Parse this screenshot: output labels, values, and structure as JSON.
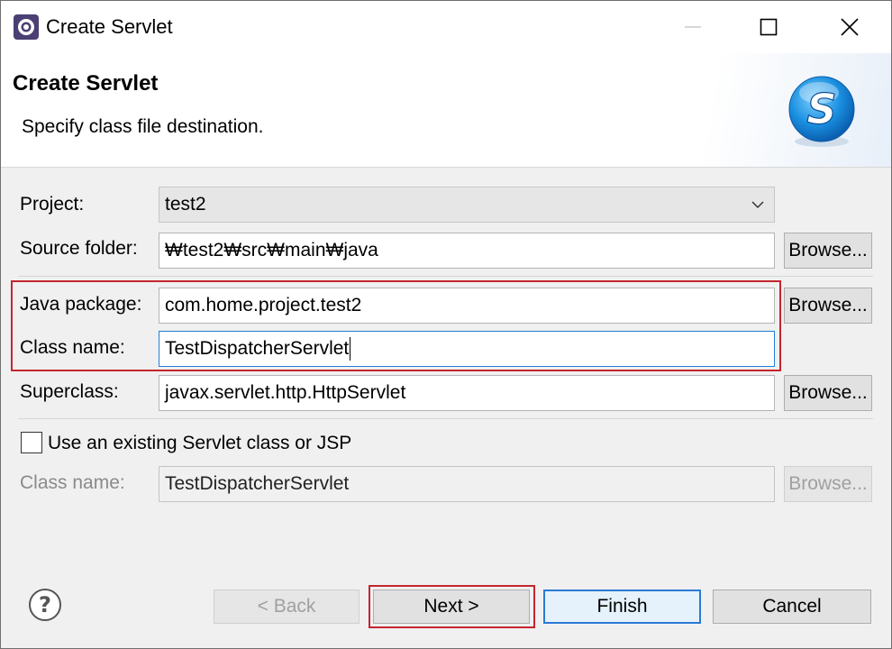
{
  "window": {
    "title": "Create Servlet",
    "controls": {
      "minimize": "minimize",
      "maximize": "maximize",
      "close": "close"
    }
  },
  "banner": {
    "title": "Create Servlet",
    "message": "Specify class file destination.",
    "logo_letter": "S"
  },
  "form": {
    "project_label": "Project:",
    "project_value": "test2",
    "source_folder_label": "Source folder:",
    "source_folder_value": "₩test2₩src₩main₩java",
    "java_package_label": "Java package:",
    "java_package_value": "com.home.project.test2",
    "class_name_label": "Class name:",
    "class_name_value": "TestDispatcherServlet",
    "superclass_label": "Superclass:",
    "superclass_value": "javax.servlet.http.HttpServlet",
    "browse_label": "Browse...",
    "use_existing_label": "Use an existing Servlet class or JSP",
    "use_existing_checked": false,
    "existing_class_name_label": "Class name:",
    "existing_class_name_value": "TestDispatcherServlet"
  },
  "footer": {
    "back_label": "< Back",
    "next_label": "Next >",
    "finish_label": "Finish",
    "cancel_label": "Cancel"
  },
  "colors": {
    "highlight_red": "#c4262e",
    "focus_blue": "#1f7fd8",
    "logo_blue": "#1a8fe0"
  },
  "icons": [
    "app-icon",
    "minimize-icon",
    "maximize-icon",
    "close-icon",
    "servlet-logo-icon",
    "chevron-down-icon",
    "help-icon"
  ]
}
